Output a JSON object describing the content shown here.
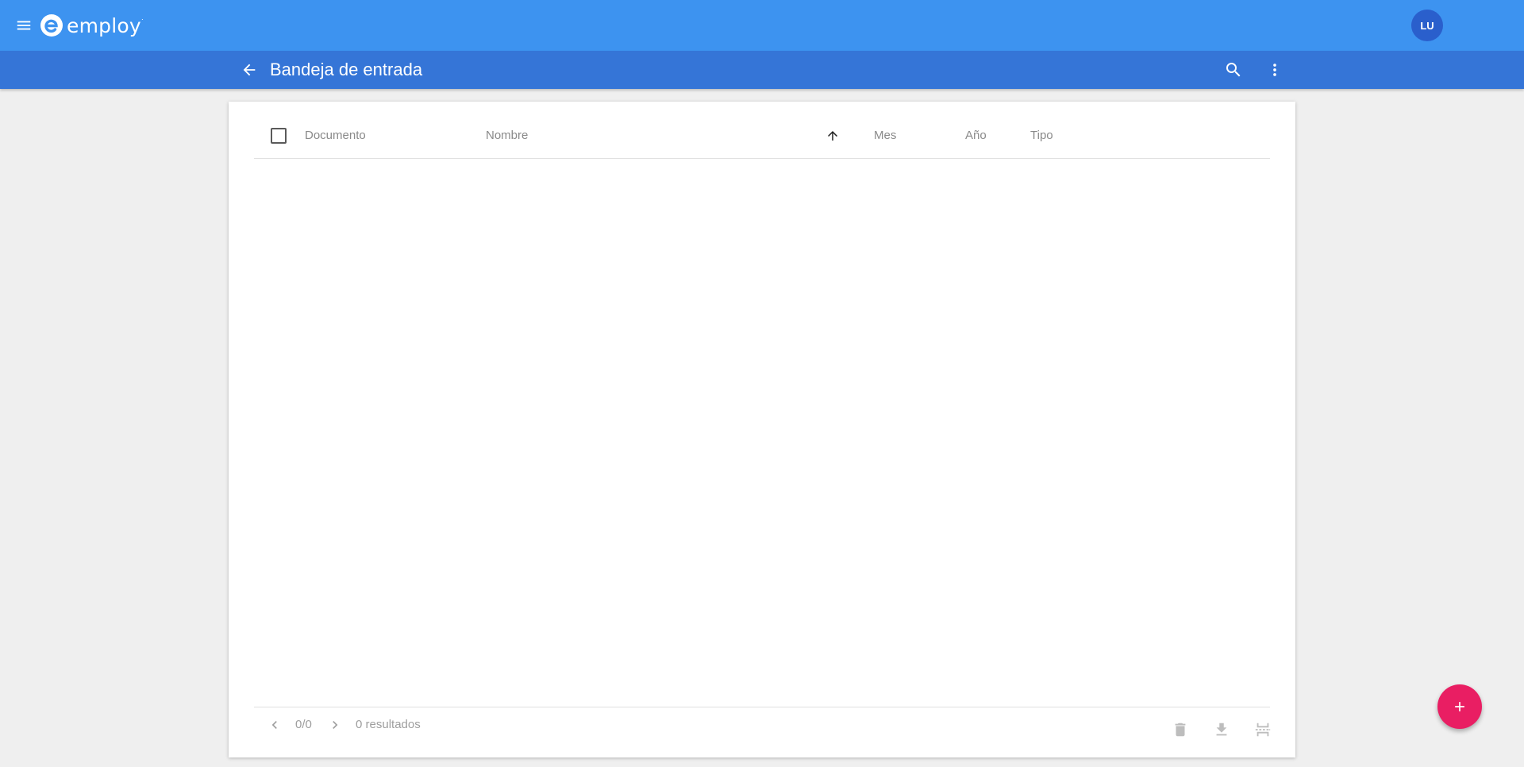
{
  "app": {
    "logo_text": "employ",
    "logo_tm": "·",
    "user_initials": "LU",
    "brand_color": "#3d93f0",
    "subbar_color": "#3575d7",
    "accent_color": "#e91e63"
  },
  "header": {
    "title": "Bandeja de entrada",
    "icons": [
      "menu-icon",
      "arrow-back-icon",
      "search-icon",
      "more-vert-icon"
    ]
  },
  "table": {
    "columns": [
      {
        "label": "Documento"
      },
      {
        "label": "Nombre",
        "sorted": "ascending"
      },
      {
        "label": "Mes"
      },
      {
        "label": "Año"
      },
      {
        "label": "Tipo"
      }
    ],
    "rows": []
  },
  "footer": {
    "page_indicator": "0/0",
    "results_text": "0 resultados",
    "actions": [
      "delete-icon",
      "download-icon",
      "split-icon"
    ]
  },
  "fab": {
    "icon": "plus-icon"
  }
}
